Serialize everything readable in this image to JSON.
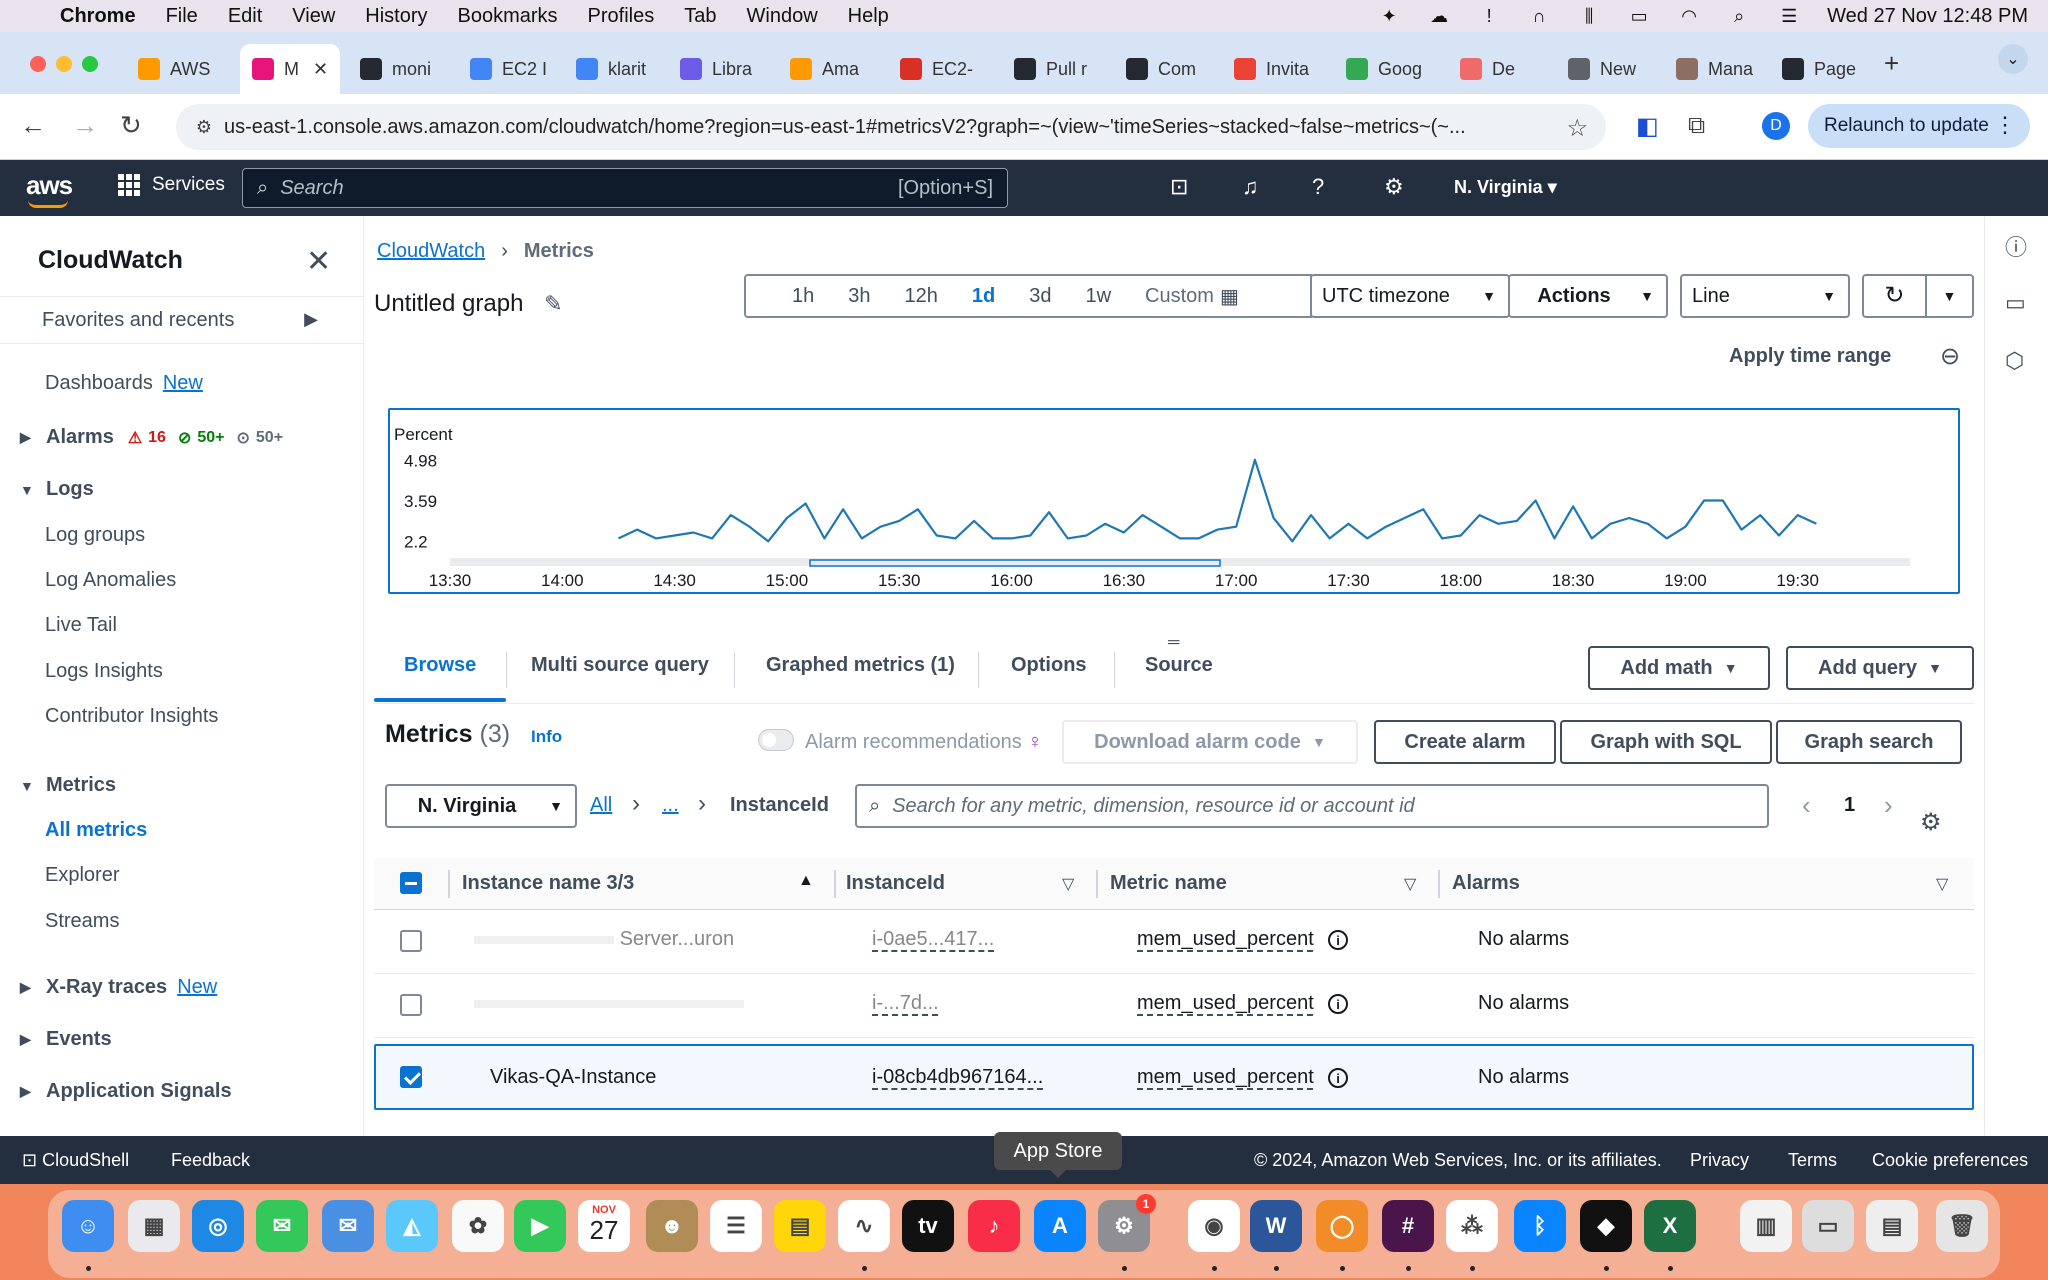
{
  "menubar": {
    "app": "Chrome",
    "items": [
      "File",
      "Edit",
      "View",
      "History",
      "Bookmarks",
      "Profiles",
      "Tab",
      "Window",
      "Help"
    ],
    "datetime": "Wed 27 Nov  12:48 PM"
  },
  "tabs": [
    {
      "label": "AWS",
      "color": "#ff9900"
    },
    {
      "label": "M",
      "color": "#e7157b",
      "active": true
    },
    {
      "label": "moni",
      "color": "#24292f"
    },
    {
      "label": "EC2 I",
      "color": "#4285f4"
    },
    {
      "label": "klarit",
      "color": "#4285f4"
    },
    {
      "label": "Libra",
      "color": "#6c5ce7"
    },
    {
      "label": "Ama",
      "color": "#ff9900"
    },
    {
      "label": "EC2-",
      "color": "#d93025"
    },
    {
      "label": "Pull r",
      "color": "#24292f"
    },
    {
      "label": "Com",
      "color": "#24292f"
    },
    {
      "label": "Invita",
      "color": "#ea4335"
    },
    {
      "label": "Goog",
      "color": "#34a853"
    },
    {
      "label": "De",
      "color": "#f06a6a"
    },
    {
      "label": "New",
      "color": "#5f6368"
    },
    {
      "label": "Mana",
      "color": "#8d6e63"
    },
    {
      "label": "Page",
      "color": "#24292f"
    }
  ],
  "browser": {
    "url": "us-east-1.console.aws.amazon.com/cloudwatch/home?region=us-east-1#metricsV2?graph=~(view~'timeSeries~stacked~false~metrics~(~...",
    "profile_initial": "D",
    "relaunch": "Relaunch to update"
  },
  "awsnav": {
    "logo": "aws",
    "services": "Services",
    "search_placeholder": "Search",
    "search_shortcut": "[Option+S]",
    "region": "N. Virginia"
  },
  "sidebar": {
    "title": "CloudWatch",
    "favorites": "Favorites and recents",
    "dashboards": "Dashboards",
    "new": "New",
    "alarms": "Alarms",
    "alarm_in_alarm": "16",
    "alarm_ok": "50+",
    "alarm_insufficient": "50+",
    "logs": "Logs",
    "log_items": [
      "Log groups",
      "Log Anomalies",
      "Live Tail",
      "Logs Insights",
      "Contributor Insights"
    ],
    "metrics": "Metrics",
    "metric_items": [
      "All metrics",
      "Explorer",
      "Streams"
    ],
    "xray": "X-Ray traces",
    "events": "Events",
    "app_signals": "Application Signals"
  },
  "main": {
    "breadcrumb_root": "CloudWatch",
    "breadcrumb_current": "Metrics",
    "graph_title": "Untitled graph",
    "time_ranges": [
      "1h",
      "3h",
      "12h",
      "1d",
      "3d",
      "1w"
    ],
    "selected_range": "1d",
    "custom": "Custom",
    "timezone": "UTC timezone",
    "actions": "Actions",
    "graph_type": "Line",
    "apply_time_range": "Apply time range"
  },
  "chart_data": {
    "type": "line",
    "ylabel": "Percent",
    "yticks": [
      "4.98",
      "3.59",
      "2.2"
    ],
    "ylim": [
      1.9,
      5.2
    ],
    "xticks": [
      "13:30",
      "14:00",
      "14:30",
      "15:00",
      "15:30",
      "16:00",
      "16:30",
      "17:00",
      "17:30",
      "18:00",
      "18:30",
      "19:00",
      "19:30"
    ],
    "x_minutes": [
      855,
      860,
      865,
      870,
      875,
      880,
      885,
      890,
      895,
      900,
      905,
      910,
      915,
      920,
      925,
      930,
      935,
      940,
      945,
      950,
      955,
      960,
      965,
      970,
      975,
      980,
      985,
      990,
      995,
      1000,
      1005,
      1010,
      1015,
      1020,
      1025,
      1030,
      1035,
      1040,
      1045,
      1050,
      1055,
      1060,
      1065,
      1070,
      1075,
      1080,
      1085,
      1090,
      1095,
      1100,
      1105,
      1110,
      1115,
      1120,
      1125,
      1130,
      1135,
      1140,
      1145,
      1150,
      1155,
      1160,
      1165,
      1170,
      1175
    ],
    "values": [
      2.3,
      2.6,
      2.3,
      2.4,
      2.5,
      2.3,
      3.1,
      2.7,
      2.2,
      3.0,
      3.5,
      2.3,
      3.3,
      2.3,
      2.7,
      2.9,
      3.3,
      2.4,
      2.3,
      2.9,
      2.3,
      2.3,
      2.4,
      3.2,
      2.3,
      2.4,
      2.8,
      2.5,
      3.1,
      2.7,
      2.3,
      2.3,
      2.6,
      2.7,
      5.0,
      3.0,
      2.2,
      3.1,
      2.3,
      2.8,
      2.3,
      2.7,
      3.0,
      3.3,
      2.3,
      2.4,
      3.1,
      2.8,
      2.9,
      3.6,
      2.3,
      3.4,
      2.3,
      2.8,
      3.0,
      2.8,
      2.3,
      2.7,
      3.6,
      3.6,
      2.6,
      3.1,
      2.4,
      3.1,
      2.8
    ],
    "grid": false,
    "legend": "none"
  },
  "panel": {
    "tabs": [
      "Browse",
      "Multi source query",
      "Graphed metrics (1)",
      "Options",
      "Source"
    ],
    "add_math": "Add math",
    "add_query": "Add query",
    "metrics_title": "Metrics",
    "metrics_count": "(3)",
    "info": "Info",
    "alarm_recommendations": "Alarm recommendations",
    "download_alarm_code": "Download alarm code",
    "create_alarm": "Create alarm",
    "graph_with_sql": "Graph with SQL",
    "graph_search": "Graph search",
    "region_filter": "N. Virginia",
    "crumb_all": "All",
    "crumb_dots": "...",
    "crumb_instance": "InstanceId",
    "search_placeholder": "Search for any metric, dimension, resource id or account id",
    "page": "1"
  },
  "table": {
    "headers": [
      "Instance name 3/3",
      "InstanceId",
      "Metric name",
      "Alarms"
    ],
    "rows": [
      {
        "name": "Server...uron",
        "id": "i-0ae5...417...",
        "metric": "mem_used_percent",
        "alarms": "No alarms",
        "checked": false
      },
      {
        "name": "",
        "id": "i-...7d...",
        "metric": "mem_used_percent",
        "alarms": "No alarms",
        "checked": false
      },
      {
        "name": "Vikas-QA-Instance",
        "id": "i-08cb4db967164...",
        "metric": "mem_used_percent",
        "alarms": "No alarms",
        "checked": true
      }
    ]
  },
  "footer": {
    "cloudshell": "CloudShell",
    "feedback": "Feedback",
    "copyright": "© 2024, Amazon Web Services, Inc. or its affiliates.",
    "privacy": "Privacy",
    "terms": "Terms",
    "cookies": "Cookie preferences"
  },
  "dock": {
    "tooltip": "App Store",
    "calendar_month": "NOV",
    "calendar_day": "27",
    "settings_badge": "1"
  }
}
